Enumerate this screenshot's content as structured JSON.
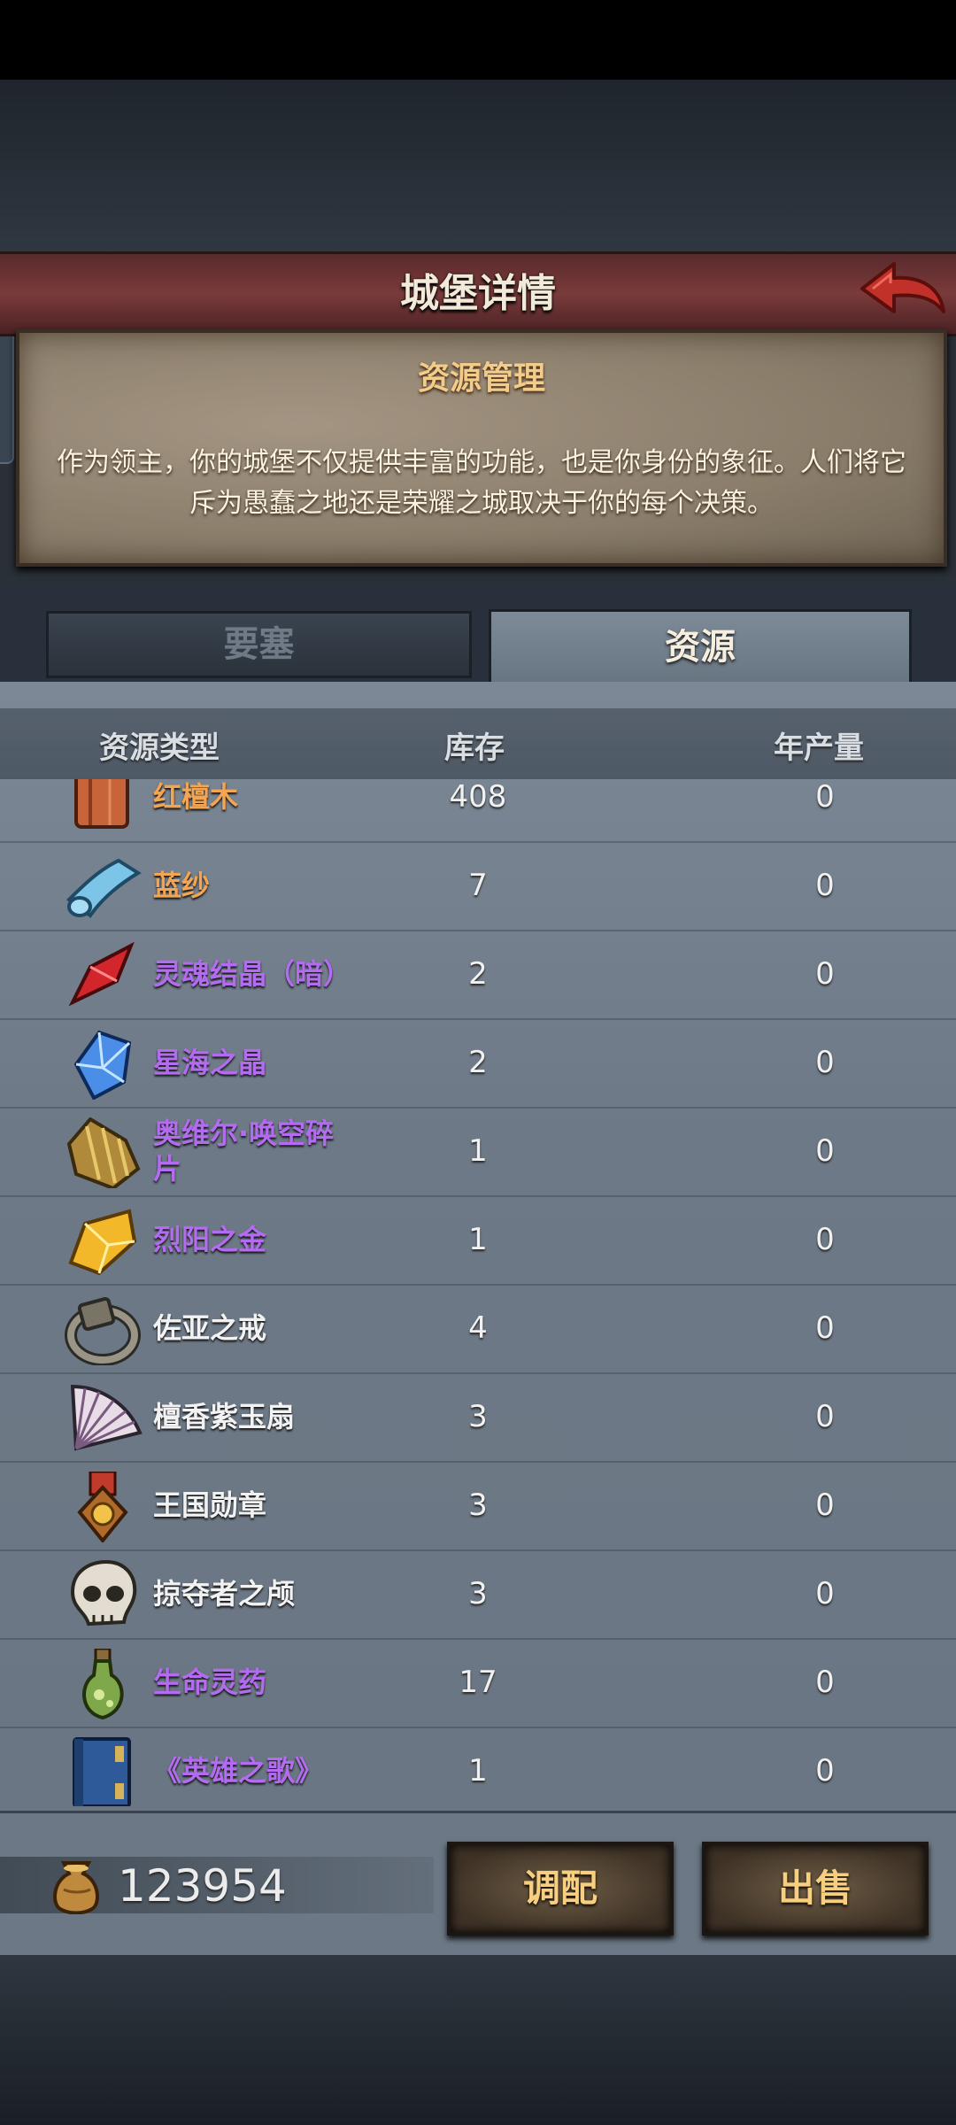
{
  "header": {
    "title": "城堡详情"
  },
  "intro": {
    "title": "资源管理",
    "body": "作为领主，你的城堡不仅提供丰富的功能，也是你身份的象征。人们将它斥为愚蠢之地还是荣耀之城取决于你的每个决策。"
  },
  "tabs": [
    {
      "label": "要塞",
      "active": false
    },
    {
      "label": "资源",
      "active": true
    }
  ],
  "columns": {
    "type": "资源类型",
    "stock": "库存",
    "yearly": "年产量"
  },
  "colors": {
    "orange": "#f2a552",
    "purple": "#b36cf0",
    "white": "#f2f2f2"
  },
  "resources": [
    {
      "icon": "red-sandalwood-icon",
      "name": "红檀木",
      "stock": "408",
      "yearly": "0",
      "color": "#f2a552"
    },
    {
      "icon": "blue-silk-icon",
      "name": "蓝纱",
      "stock": "7",
      "yearly": "0",
      "color": "#f2a552"
    },
    {
      "icon": "dark-soul-crystal-icon",
      "name": "灵魂结晶（暗）",
      "stock": "2",
      "yearly": "0",
      "color": "#b36cf0"
    },
    {
      "icon": "star-sea-crystal-icon",
      "name": "星海之晶",
      "stock": "2",
      "yearly": "0",
      "color": "#b36cf0"
    },
    {
      "icon": "ovir-shard-icon",
      "name": "奥维尔·唤空碎片",
      "stock": "1",
      "yearly": "0",
      "color": "#b36cf0"
    },
    {
      "icon": "blazing-gold-icon",
      "name": "烈阳之金",
      "stock": "1",
      "yearly": "0",
      "color": "#b36cf0"
    },
    {
      "icon": "zoya-ring-icon",
      "name": "佐亚之戒",
      "stock": "4",
      "yearly": "0",
      "color": "#f2f2f2"
    },
    {
      "icon": "jade-fan-icon",
      "name": "檀香紫玉扇",
      "stock": "3",
      "yearly": "0",
      "color": "#f2f2f2"
    },
    {
      "icon": "kingdom-medal-icon",
      "name": "王国勋章",
      "stock": "3",
      "yearly": "0",
      "color": "#f2f2f2"
    },
    {
      "icon": "raider-skull-icon",
      "name": "掠夺者之颅",
      "stock": "3",
      "yearly": "0",
      "color": "#f2f2f2"
    },
    {
      "icon": "life-elixir-icon",
      "name": "生命灵药",
      "stock": "17",
      "yearly": "0",
      "color": "#b36cf0"
    },
    {
      "icon": "hero-song-book-icon",
      "name": "《英雄之歌》",
      "stock": "1",
      "yearly": "0",
      "color": "#b36cf0"
    }
  ],
  "footer": {
    "gold_icon": "gold-bag-icon",
    "gold": "123954",
    "allocate_label": "调配",
    "sell_label": "出售"
  }
}
